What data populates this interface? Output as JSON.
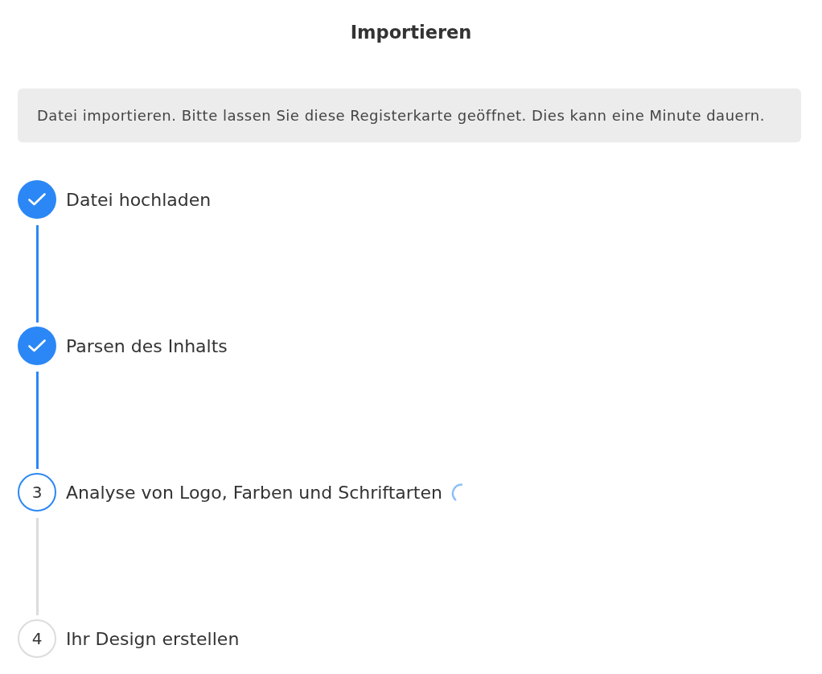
{
  "title": "Importieren",
  "notice": "Datei importieren. Bitte lassen Sie diese Registerkarte geöffnet. Dies kann eine Minute dauern.",
  "steps": [
    {
      "label": "Datei hochladen",
      "done": true,
      "active": false
    },
    {
      "label": "Parsen des Inhalts",
      "done": true,
      "active": false
    },
    {
      "number": "3",
      "label": "Analyse von Logo, Farben und Schriftarten",
      "done": false,
      "active": true
    },
    {
      "number": "4",
      "label": "Ihr Design erstellen",
      "done": false,
      "active": false
    }
  ]
}
